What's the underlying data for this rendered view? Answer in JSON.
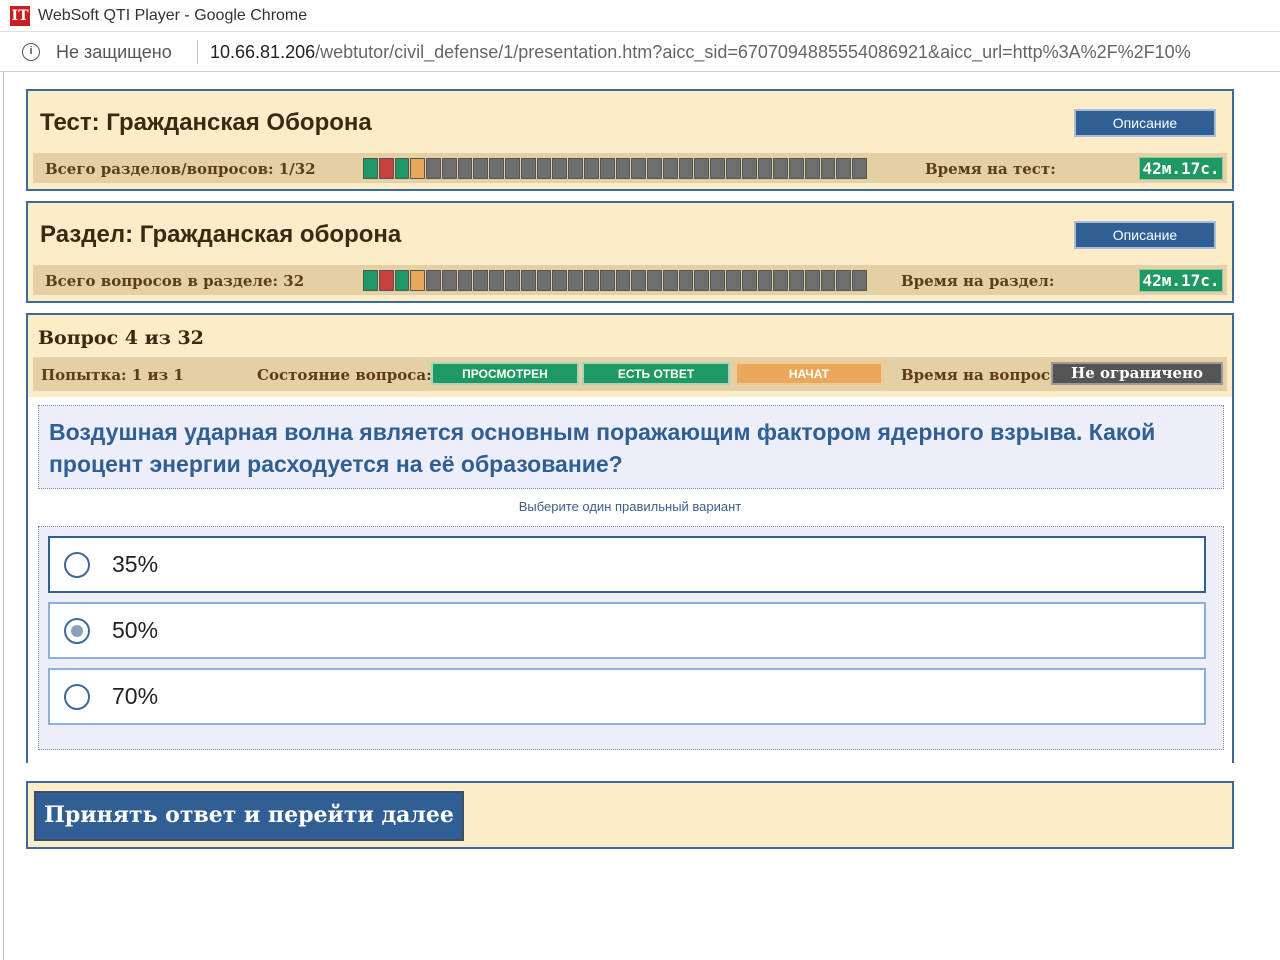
{
  "window": {
    "title": "WebSoft QTI Player - Google Chrome",
    "logo_text": "IT"
  },
  "addressbar": {
    "security_text": "Не защищено",
    "url_host": "10.66.81.206",
    "url_path": "/webtutor/civil_defense/1/presentation.htm?aicc_sid=6707094885554086921&aicc_url=http%3A%2F%2F10%"
  },
  "test": {
    "title": "Тест: Гражданская Оборона",
    "description_button": "Описание",
    "progress_label": "Всего разделов/вопросов: 1/32",
    "time_label": "Время на тест:",
    "time_value": "42м.17с.",
    "progress_total": 32,
    "progress_states": [
      "answered",
      "viewed",
      "answered",
      "started"
    ]
  },
  "section": {
    "title": "Раздел: Гражданская оборона",
    "description_button": "Описание",
    "progress_label": "Всего вопросов в разделе: 32",
    "time_label": "Время на раздел:",
    "time_value": "42м.17с.",
    "progress_total": 32,
    "progress_states": [
      "answered",
      "viewed",
      "answered",
      "started"
    ]
  },
  "question": {
    "number_text": "Вопрос 4 из 32",
    "attempt_text": "Попытка: 1 из 1",
    "state_label": "Состояние вопроса:",
    "states": [
      "ПРОСМОТРЕН",
      "ЕСТЬ ОТВЕТ",
      "НАЧАТ"
    ],
    "time_label": "Время на вопрос:",
    "time_value": "Не ограничено",
    "text": "Воздушная ударная волна является основным поражающим фактором ядерного взрыва. Какой процент энергии расходуется на её образование?",
    "instruction": "Выберите один правильный вариант",
    "options": [
      {
        "label": "35%",
        "selected": false
      },
      {
        "label": "50%",
        "selected": true
      },
      {
        "label": "70%",
        "selected": false
      }
    ]
  },
  "submit_button": "Принять ответ и перейти далее",
  "colors": {
    "panel_bg": "#fdecc8",
    "panel_border": "#3d6a9b",
    "accent_blue": "#2f5f95",
    "state_green": "#1f9963",
    "state_red": "#c94040",
    "state_orange": "#e9a85c",
    "segment_empty": "#6e6e6e"
  }
}
